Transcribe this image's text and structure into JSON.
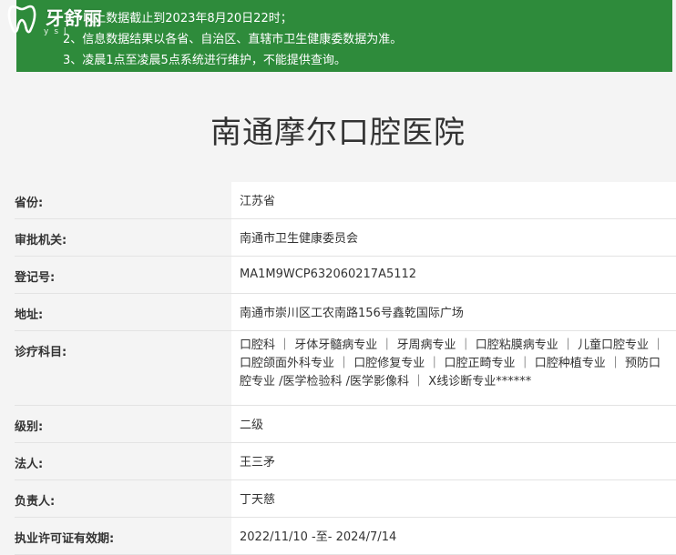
{
  "logo": {
    "brand": "牙舒丽",
    "sub": "ysl"
  },
  "notice": {
    "lines": [
      "1、以上数据截止到2023年8月20日22时；",
      "2、信息数据结果以各省、自治区、直辖市卫生健康委数据为准。",
      "3、凌晨1点至凌晨5点系统进行维护，不能提供查询。"
    ]
  },
  "hospital": {
    "name": "南通摩尔口腔医院"
  },
  "fields": [
    {
      "label": "省份:",
      "value": "江苏省"
    },
    {
      "label": "审批机关:",
      "value": "南通市卫生健康委员会"
    },
    {
      "label": "登记号:",
      "value": "MA1M9WCP632060217A5112"
    },
    {
      "label": "地址:",
      "value": "南通市崇川区工农南路156号鑫乾国际广场"
    },
    {
      "label": "诊疗科目:",
      "value": "口腔科 ｜ 牙体牙髓病专业 ｜ 牙周病专业 ｜ 口腔粘膜病专业 ｜ 儿童口腔专业 ｜ 口腔颌面外科专业 ｜ 口腔修复专业 ｜ 口腔正畸专业 ｜ 口腔种植专业 ｜ 预防口腔专业 /医学检验科 /医学影像科 ｜ X线诊断专业******"
    },
    {
      "label": "级别:",
      "value": "二级"
    },
    {
      "label": "法人:",
      "value": "王三矛"
    },
    {
      "label": "负责人:",
      "value": "丁天慈"
    },
    {
      "label": "执业许可证有效期:",
      "value": "2022/11/10 -至- 2024/7/14"
    }
  ],
  "colors": {
    "notice_bg": "#2e8b3b",
    "label_bg": "#f4f4f4",
    "value_bg": "#ffffff"
  }
}
